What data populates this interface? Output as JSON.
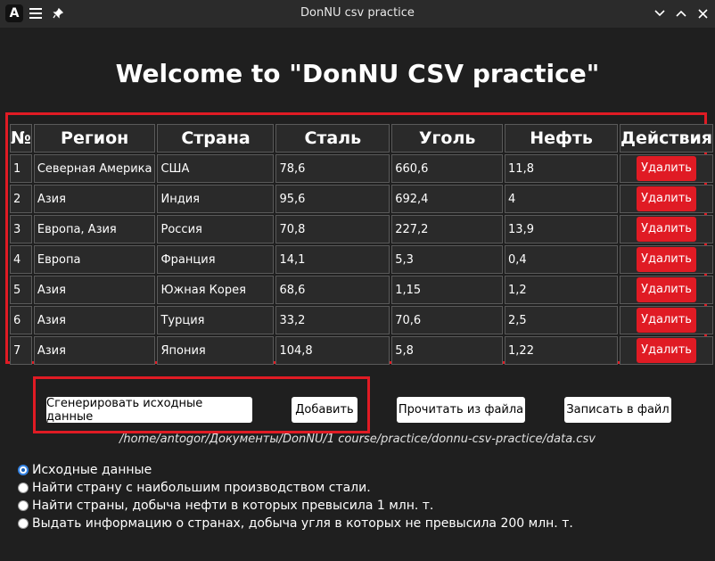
{
  "window": {
    "title": "DonNU csv practice"
  },
  "page": {
    "heading": "Welcome to \"DonNU CSV practice\""
  },
  "table": {
    "headers": [
      "№",
      "Регион",
      "Страна",
      "Сталь",
      "Уголь",
      "Нефть",
      "Действия"
    ],
    "rows": [
      [
        "1",
        "Северная Америка",
        "США",
        "78,6",
        "660,6",
        "11,8"
      ],
      [
        "2",
        "Азия",
        "Индия",
        "95,6",
        "692,4",
        "4"
      ],
      [
        "3",
        "Европа, Азия",
        "Россия",
        "70,8",
        "227,2",
        "13,9"
      ],
      [
        "4",
        "Европа",
        "Франция",
        "14,1",
        "5,3",
        "0,4"
      ],
      [
        "5",
        "Азия",
        "Южная Корея",
        "68,6",
        "1,15",
        "1,2"
      ],
      [
        "6",
        "Азия",
        "Турция",
        "33,2",
        "70,6",
        "2,5"
      ],
      [
        "7",
        "Азия",
        "Япония",
        "104,8",
        "5,8",
        "1,22"
      ]
    ],
    "delete_label": "Удалить"
  },
  "buttons": {
    "generate": "Сгенерировать исходные данные",
    "add": "Добавить",
    "read": "Прочитать из файла",
    "write": "Записать в файл"
  },
  "file_path": "/home/antogor/Документы/DonNU/1 course/practice/donnu-csv-practice/data.csv",
  "options": [
    {
      "label": "Исходные данные",
      "checked": true
    },
    {
      "label": "Найти страну с наибольшим производством стали.",
      "checked": false
    },
    {
      "label": "Найти страны, добыча нефти в которых превысила 1 млн. т.",
      "checked": false
    },
    {
      "label": "Выдать информацию о странах, добыча угля в которых не превысила 200 млн. т.",
      "checked": false
    }
  ],
  "colors": {
    "accent_red": "#e01b24",
    "background": "#1f1f1f",
    "radio_selected": "#3584e4"
  }
}
